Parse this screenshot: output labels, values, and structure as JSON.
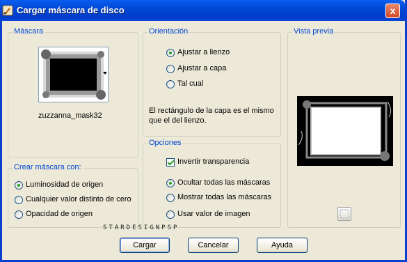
{
  "window": {
    "title": "Cargar máscara de disco",
    "icon": "paintbrush-app-icon",
    "close_label": "x"
  },
  "mascara": {
    "label": "Máscara",
    "mask_name": "zuzzanna_mask32"
  },
  "crear_mascara": {
    "label": "Crear máscara con:",
    "options": [
      {
        "label": "Luminosidad de origen",
        "selected": true
      },
      {
        "label": "Cualquier valor distinto de cero",
        "selected": false
      },
      {
        "label": "Opacidad de origen",
        "selected": false
      }
    ]
  },
  "orientacion": {
    "label": "Orientación",
    "options": [
      {
        "label": "Ajustar a lienzo",
        "selected": true
      },
      {
        "label": "Ajustar a capa",
        "selected": false
      },
      {
        "label": "Tal cual",
        "selected": false
      }
    ],
    "description": "El rectángulo de la capa es el mismo que el del lienzo."
  },
  "opciones": {
    "label": "Opciones",
    "invertir": {
      "label": "Invertir transparencia",
      "checked": true
    },
    "options": [
      {
        "label": "Ocultar todas las máscaras",
        "selected": true
      },
      {
        "label": "Mostrar todas las máscaras",
        "selected": false
      },
      {
        "label": "Usar valor de imagen",
        "selected": false
      }
    ]
  },
  "vista_previa": {
    "label": "Vista previa"
  },
  "watermark": "STARDESIGNPSP",
  "buttons": {
    "cargar": "Cargar",
    "cancelar": "Cancelar",
    "ayuda": "Ayuda"
  },
  "colors": {
    "title_bar": "#0054e3",
    "group_label": "#0046d5",
    "dialog_bg": "#ece9d8",
    "radio_dot": "#21a121"
  }
}
